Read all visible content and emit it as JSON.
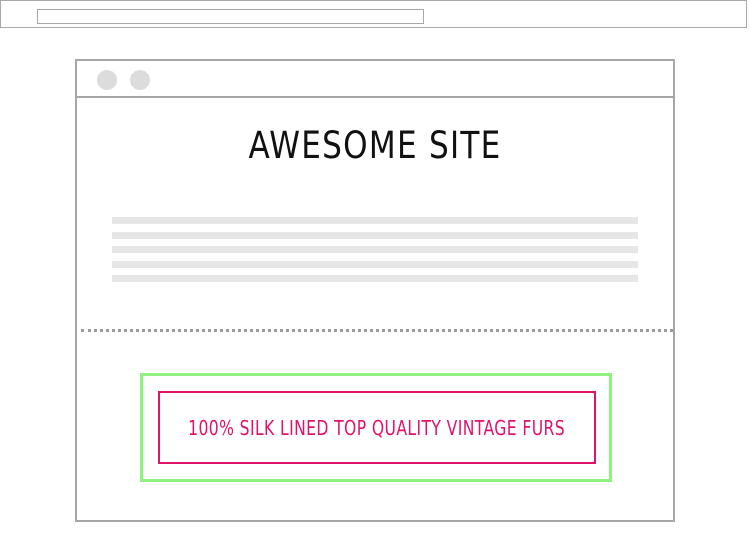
{
  "site": {
    "title": "AWESOME SITE"
  },
  "banner": {
    "text": "100% SILK LINED TOP QUALITY VINTAGE FURS"
  },
  "colors": {
    "frame": "#a7a7a7",
    "placeholder_text": "#e6e6e6",
    "window_dots": "#dcdcdc",
    "highlight_box": "#8ef27f",
    "banner_accent": "#e0136b",
    "title_text": "#111111"
  }
}
